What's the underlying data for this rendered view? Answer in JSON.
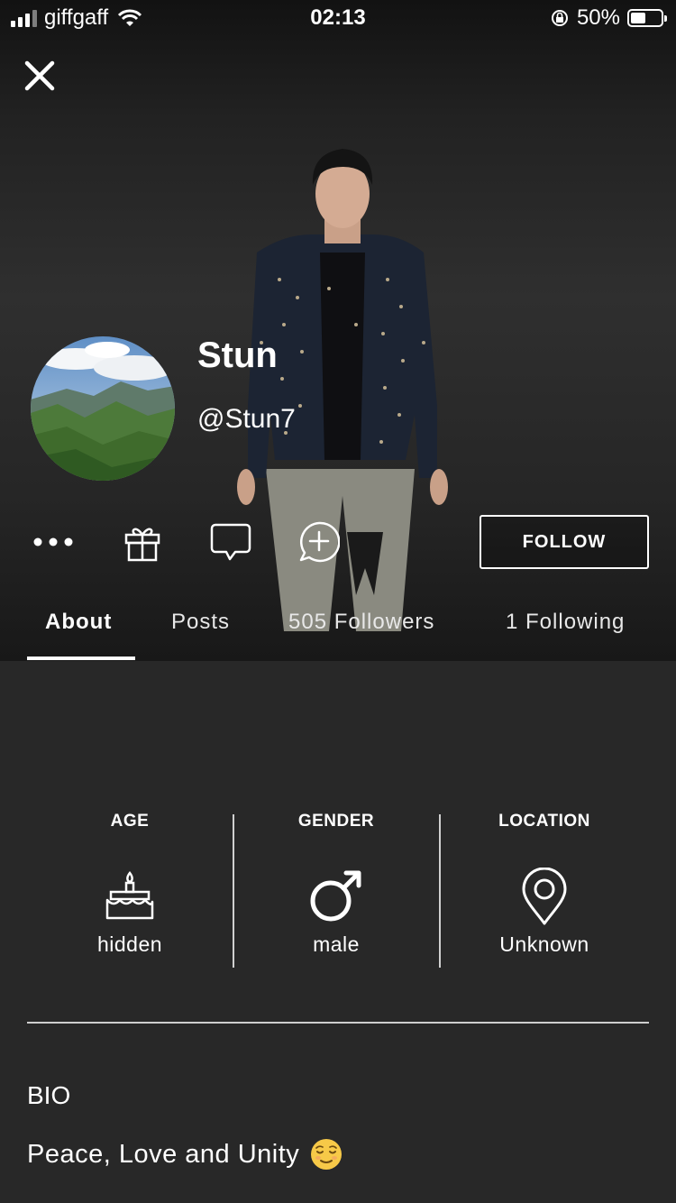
{
  "status_bar": {
    "carrier": "giffgaff",
    "time": "02:13",
    "battery_percent": "50%",
    "battery_level": 0.5,
    "icons": [
      "signal-icon",
      "wifi-icon",
      "orientation-lock-icon",
      "battery-icon"
    ]
  },
  "header": {
    "close_icon": "close-icon"
  },
  "profile": {
    "display_name": "Stun",
    "username": "@Stun7"
  },
  "actions": {
    "more_icon": "more-icon",
    "gift_icon": "gift-icon",
    "chat_icon": "chat-icon",
    "add_chat_icon": "add-chat-icon",
    "follow_label": "FOLLOW"
  },
  "tabs": [
    {
      "label": "About",
      "active": true
    },
    {
      "label": "Posts",
      "active": false
    },
    {
      "label": "505 Followers",
      "active": false
    },
    {
      "label": "1 Following",
      "active": false
    }
  ],
  "about": {
    "age": {
      "label": "AGE",
      "value": "hidden",
      "icon": "cake-icon"
    },
    "gender": {
      "label": "GENDER",
      "value": "male",
      "icon": "male-icon"
    },
    "location": {
      "label": "LOCATION",
      "value": "Unknown",
      "icon": "location-pin-icon"
    }
  },
  "bio": {
    "label": "BIO",
    "text": "Peace, Love and Unity",
    "emoji": "😌"
  },
  "colors": {
    "background": "#282828",
    "text": "#ffffff"
  }
}
